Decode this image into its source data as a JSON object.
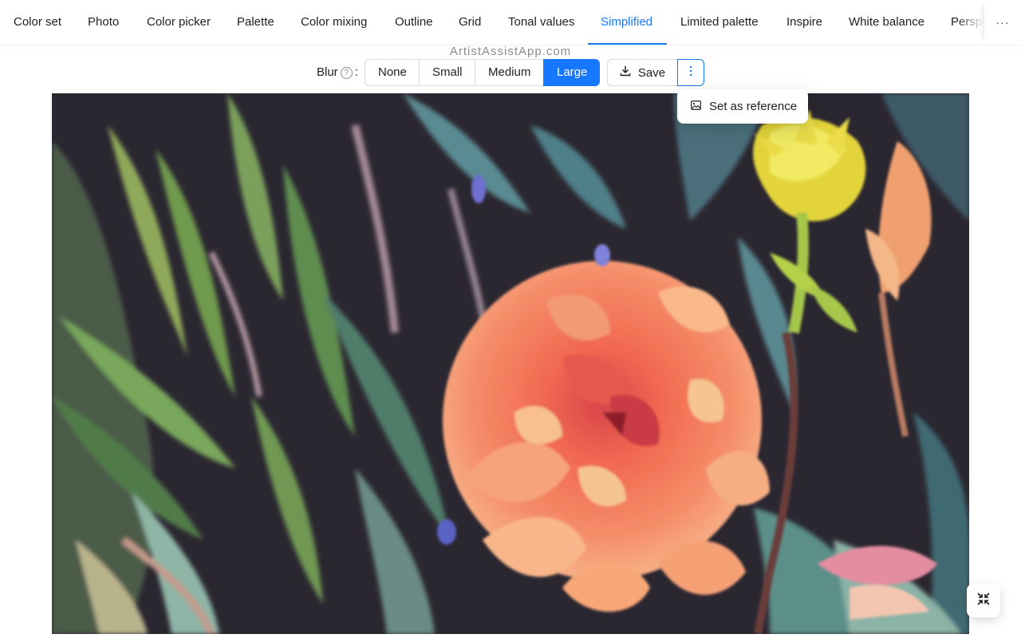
{
  "tabs": [
    {
      "label": "Color set"
    },
    {
      "label": "Photo"
    },
    {
      "label": "Color picker"
    },
    {
      "label": "Palette"
    },
    {
      "label": "Color mixing"
    },
    {
      "label": "Outline"
    },
    {
      "label": "Grid"
    },
    {
      "label": "Tonal values"
    },
    {
      "label": "Simplified"
    },
    {
      "label": "Limited palette"
    },
    {
      "label": "Inspire"
    },
    {
      "label": "White balance"
    },
    {
      "label": "Perspective"
    }
  ],
  "active_tab": "Simplified",
  "tab_more_label": "···",
  "watermark": "ArtistAssistApp.com",
  "toolbar": {
    "blur_label": "Blur",
    "blur_suffix": ":",
    "help_glyph": "?",
    "blur_options": [
      {
        "label": "None"
      },
      {
        "label": "Small"
      },
      {
        "label": "Medium"
      },
      {
        "label": "Large"
      }
    ],
    "selected_blur": "Large",
    "save_label": "Save",
    "more_glyph": "⋮"
  },
  "dropdown": {
    "items": [
      {
        "label": "Set as reference"
      }
    ]
  },
  "colors": {
    "accent": "#1677ff",
    "text": "#1f1f1f",
    "border": "#d9d9d9"
  },
  "icons": {
    "save": "download-icon",
    "reference": "image-icon",
    "fullscreen": "fullscreen-exit-icon"
  }
}
